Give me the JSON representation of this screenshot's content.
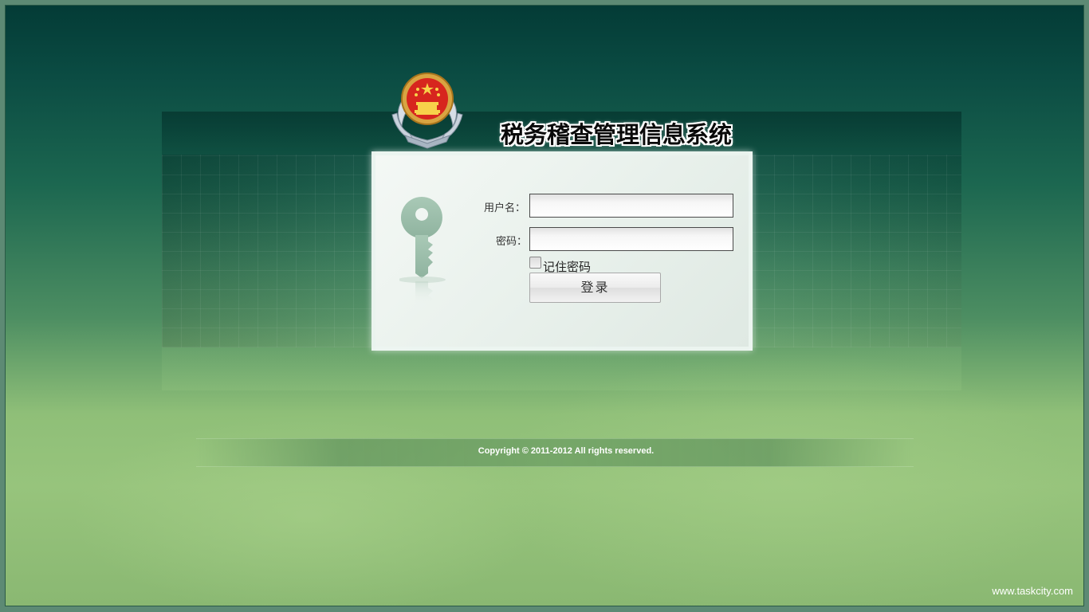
{
  "header": {
    "title": "税务稽查管理信息系统",
    "emblem_icon": "national-emblem-icon"
  },
  "login": {
    "username_label": "用户名：",
    "username_value": "",
    "password_label": "密码：",
    "password_value": "",
    "remember_label": "记住密码",
    "remember_checked": false,
    "submit_label": "登录",
    "key_icon": "key-icon"
  },
  "footer": {
    "copyright": "Copyright © 2011-2012 All rights reserved.",
    "watermark": "www.taskcity.com"
  },
  "colors": {
    "background_top": "#033b36",
    "background_bottom": "#97c47c",
    "panel": "#eef4f0",
    "title_text": "#0a0a0a"
  }
}
